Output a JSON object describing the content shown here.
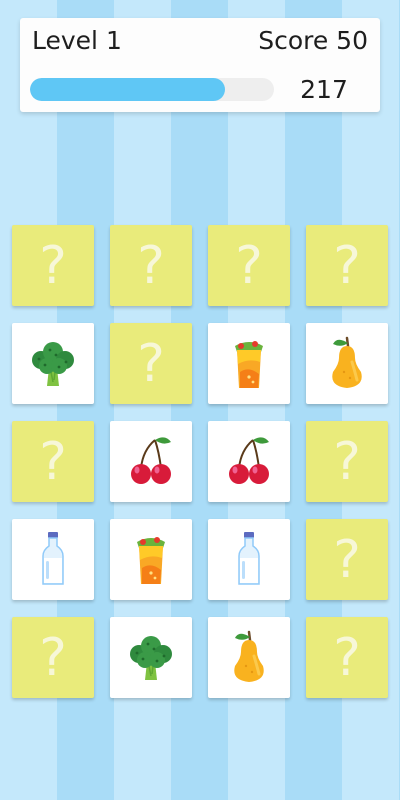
{
  "hud": {
    "level_label": "Level 1",
    "score_label": "Score 50",
    "timer": "217",
    "progress": 0.8
  },
  "cards": [
    {
      "state": "hidden",
      "symbol": "?"
    },
    {
      "state": "hidden",
      "symbol": "?"
    },
    {
      "state": "hidden",
      "symbol": "?"
    },
    {
      "state": "hidden",
      "symbol": "?"
    },
    {
      "state": "revealed",
      "icon": "broccoli-icon"
    },
    {
      "state": "hidden",
      "symbol": "?"
    },
    {
      "state": "revealed",
      "icon": "burrito-icon"
    },
    {
      "state": "revealed",
      "icon": "pear-icon"
    },
    {
      "state": "hidden",
      "symbol": "?"
    },
    {
      "state": "revealed",
      "icon": "cherries-icon"
    },
    {
      "state": "revealed",
      "icon": "cherries-icon"
    },
    {
      "state": "hidden",
      "symbol": "?"
    },
    {
      "state": "revealed",
      "icon": "milk-bottle-icon"
    },
    {
      "state": "revealed",
      "icon": "burrito-icon"
    },
    {
      "state": "revealed",
      "icon": "milk-bottle-icon"
    },
    {
      "state": "hidden",
      "symbol": "?"
    },
    {
      "state": "hidden",
      "symbol": "?"
    },
    {
      "state": "revealed",
      "icon": "broccoli-icon"
    },
    {
      "state": "revealed",
      "icon": "pear-icon"
    },
    {
      "state": "hidden",
      "symbol": "?"
    }
  ],
  "colors": {
    "card_back": "#e9eb7b",
    "card_face": "#ffffff",
    "progress_fill": "#5fc7f5"
  }
}
